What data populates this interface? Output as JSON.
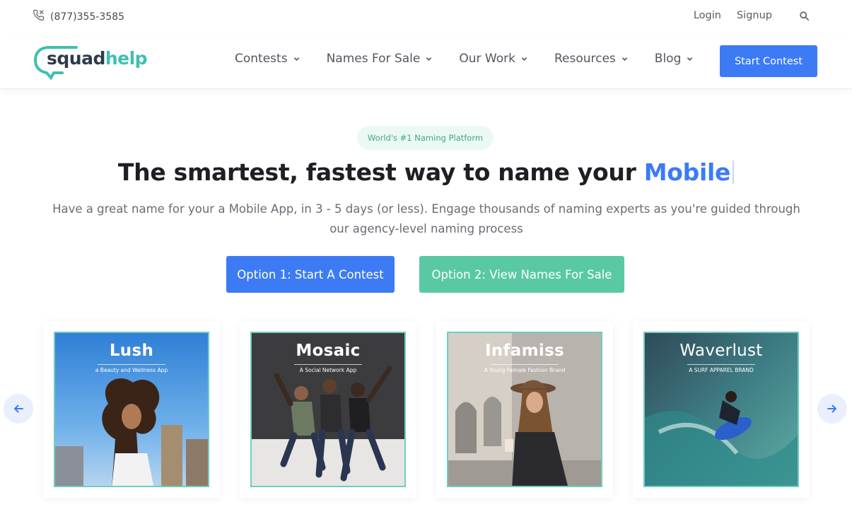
{
  "topbar": {
    "phone_icon": "phone-icon",
    "phone": "(877)355-3585",
    "login": "Login",
    "signup": "Signup",
    "search_icon": "search-icon"
  },
  "header": {
    "logo": {
      "part1": "squad",
      "part2": "help"
    },
    "nav": [
      {
        "label": "Contests"
      },
      {
        "label": "Names For Sale"
      },
      {
        "label": "Our Work"
      },
      {
        "label": "Resources"
      },
      {
        "label": "Blog"
      }
    ],
    "start_contest": "Start Contest"
  },
  "hero": {
    "badge": "World's #1 Naming Platform",
    "title": "The smartest, fastest way to name your ",
    "title_accent": "Mobile",
    "subtitle": "Have a great name for your a Mobile App, in 3 - 5 days (or less). Engage thousands of naming experts as you're guided through our agency-level naming process",
    "option1": "Option 1: Start A Contest",
    "option2": "Option 2: View Names For Sale"
  },
  "carousel": {
    "prev_icon": "arrow-left-icon",
    "next_icon": "arrow-right-icon",
    "cards": [
      {
        "name": "Lush",
        "tagline": "a Beauty and Wellness App"
      },
      {
        "name": "Mosaic",
        "tagline": "A Social Network App"
      },
      {
        "name": "Infamiss",
        "tagline": "A Young Female Fashion Brand"
      },
      {
        "name": "Waverlust",
        "tagline": "A SURF APPAREL BRAND"
      }
    ]
  },
  "colors": {
    "primary": "#3d7bf5",
    "secondary": "#59c9a3",
    "brand_teal": "#3ec0b0"
  }
}
